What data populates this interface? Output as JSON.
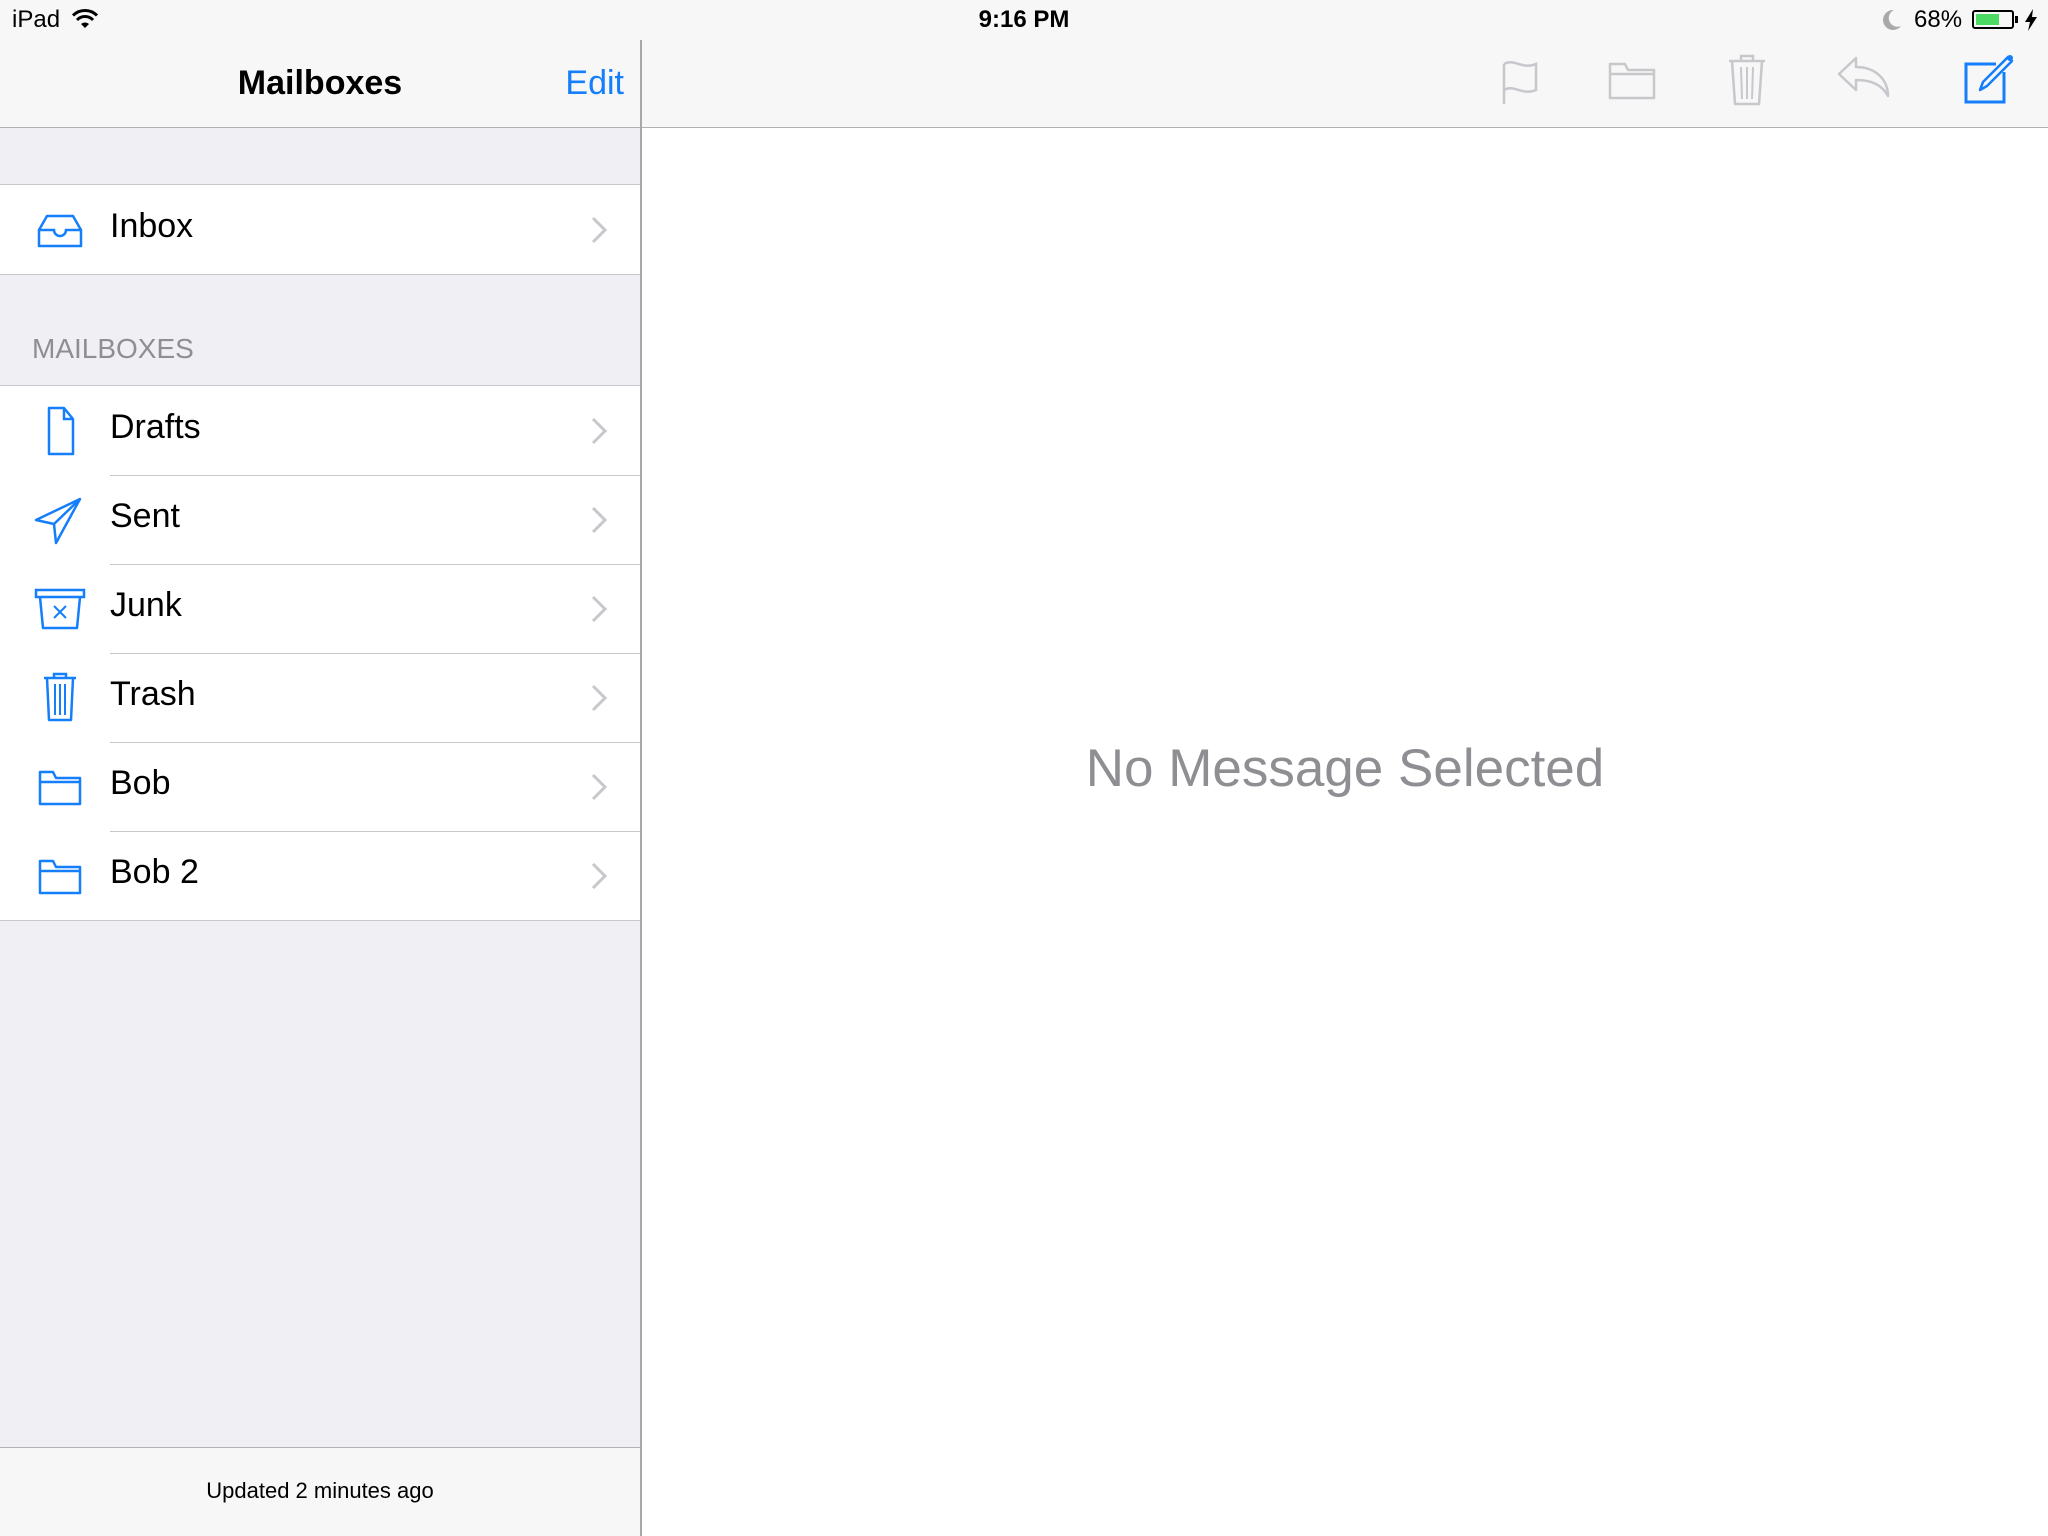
{
  "status_bar": {
    "carrier": "iPad",
    "wifi_icon": "wifi-icon",
    "time": "9:16 PM",
    "do_not_disturb_icon": "moon-icon",
    "battery_percent_label": "68%",
    "battery_level": 0.68,
    "charging_icon": "bolt-icon",
    "battery_color": "#4cd964"
  },
  "sidebar": {
    "nav": {
      "title": "Mailboxes",
      "edit_label": "Edit"
    },
    "top_group": [
      {
        "label": "Inbox",
        "icon": "inbox-tray-icon"
      }
    ],
    "section_header": "MAILBOXES",
    "mailboxes": [
      {
        "label": "Drafts",
        "icon": "document-icon"
      },
      {
        "label": "Sent",
        "icon": "paper-plane-icon"
      },
      {
        "label": "Junk",
        "icon": "junk-bin-icon"
      },
      {
        "label": "Trash",
        "icon": "trash-icon"
      },
      {
        "label": "Bob",
        "icon": "folder-icon"
      },
      {
        "label": "Bob 2",
        "icon": "folder-icon"
      }
    ],
    "footer_status": "Updated 2 minutes ago"
  },
  "detail": {
    "toolbar": [
      {
        "name": "flag",
        "icon": "flag-icon",
        "enabled": false
      },
      {
        "name": "move",
        "icon": "folder-icon",
        "enabled": false
      },
      {
        "name": "trash",
        "icon": "trash-icon",
        "enabled": false
      },
      {
        "name": "reply",
        "icon": "reply-icon",
        "enabled": false
      },
      {
        "name": "compose",
        "icon": "compose-icon",
        "enabled": true
      }
    ],
    "empty_message": "No Message Selected"
  },
  "colors": {
    "accent": "#157efb",
    "disabled_icon": "#c7c7cc",
    "secondary_text": "#8e8e93",
    "grouped_background": "#efeff4"
  }
}
